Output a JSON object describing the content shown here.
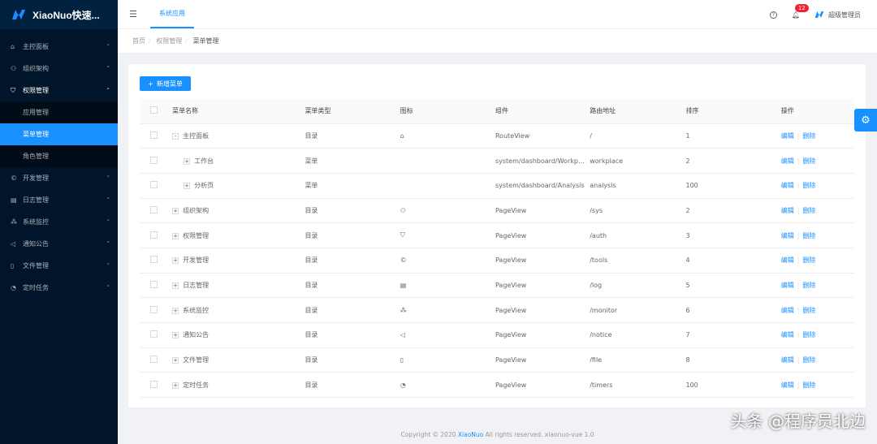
{
  "app": {
    "title": "XiaoNuo快速..."
  },
  "sidebar": {
    "items": [
      {
        "label": "主控面板",
        "icon": "home-icon"
      },
      {
        "label": "组织架构",
        "icon": "team-icon"
      },
      {
        "label": "权限管理",
        "icon": "safety-icon",
        "open": true,
        "children": [
          {
            "label": "应用管理"
          },
          {
            "label": "菜单管理",
            "selected": true
          },
          {
            "label": "角色管理"
          }
        ]
      },
      {
        "label": "开发管理",
        "icon": "copyright-icon"
      },
      {
        "label": "日志管理",
        "icon": "read-icon"
      },
      {
        "label": "系统监控",
        "icon": "cluster-icon"
      },
      {
        "label": "通知公告",
        "icon": "sound-icon"
      },
      {
        "label": "文件管理",
        "icon": "file-icon"
      },
      {
        "label": "定时任务",
        "icon": "dashboard-icon"
      }
    ]
  },
  "header": {
    "tab": "系统应用",
    "notifications": "12",
    "user": "超级管理员"
  },
  "breadcrumb": [
    "首页",
    "权限管理",
    "菜单管理"
  ],
  "toolbar": {
    "add_label": "新增菜单"
  },
  "table": {
    "columns": [
      "菜单名称",
      "菜单类型",
      "图标",
      "组件",
      "路由地址",
      "排序",
      "操作"
    ],
    "rows": [
      {
        "name": "主控面板",
        "expand": "-",
        "type": "目录",
        "icon": "⌂",
        "component": "RouteView",
        "route": "/",
        "sort": "1",
        "level": 0
      },
      {
        "name": "工作台",
        "expand": "+",
        "type": "菜单",
        "icon": "",
        "component": "system/dashboard/Workp...",
        "route": "workplace",
        "sort": "2",
        "level": 1
      },
      {
        "name": "分析页",
        "expand": "+",
        "type": "菜单",
        "icon": "",
        "component": "system/dashboard/Analysis",
        "route": "analysis",
        "sort": "100",
        "level": 1
      },
      {
        "name": "组织架构",
        "expand": "+",
        "type": "目录",
        "icon": "⚇",
        "component": "PageView",
        "route": "/sys",
        "sort": "2",
        "level": 0
      },
      {
        "name": "权限管理",
        "expand": "+",
        "type": "目录",
        "icon": "⛉",
        "component": "PageView",
        "route": "/auth",
        "sort": "3",
        "level": 0
      },
      {
        "name": "开发管理",
        "expand": "+",
        "type": "目录",
        "icon": "©",
        "component": "PageView",
        "route": "/tools",
        "sort": "4",
        "level": 0
      },
      {
        "name": "日志管理",
        "expand": "+",
        "type": "目录",
        "icon": "▤",
        "component": "PageView",
        "route": "/log",
        "sort": "5",
        "level": 0
      },
      {
        "name": "系统监控",
        "expand": "+",
        "type": "目录",
        "icon": "⁂",
        "component": "PageView",
        "route": "/monitor",
        "sort": "6",
        "level": 0
      },
      {
        "name": "通知公告",
        "expand": "+",
        "type": "目录",
        "icon": "◁",
        "component": "PageView",
        "route": "/notice",
        "sort": "7",
        "level": 0
      },
      {
        "name": "文件管理",
        "expand": "+",
        "type": "目录",
        "icon": "▯",
        "component": "PageView",
        "route": "/file",
        "sort": "8",
        "level": 0
      },
      {
        "name": "定时任务",
        "expand": "+",
        "type": "目录",
        "icon": "◔",
        "component": "PageView",
        "route": "/timers",
        "sort": "100",
        "level": 0
      }
    ],
    "edit_label": "编辑",
    "delete_label": "删除"
  },
  "footer": {
    "prefix": "Copyright © 2020 ",
    "brand": "XiaoNuo",
    "suffix": " All rights reserved. xiaonuo-vue 1.0"
  },
  "watermark": "头条 @程序员北边",
  "colors": {
    "primary": "#1890ff",
    "sidebar": "#001529"
  }
}
